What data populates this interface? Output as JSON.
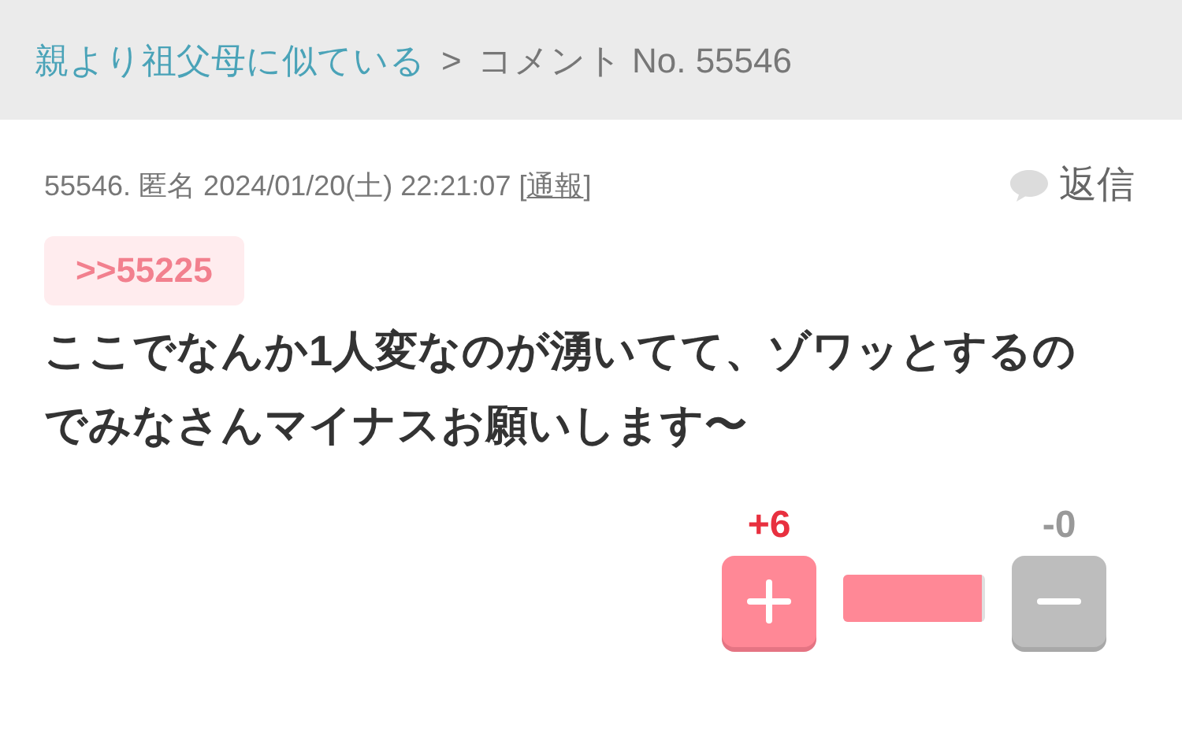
{
  "breadcrumb": {
    "link": "親より祖父母に似ている",
    "separator": ">",
    "current": "コメント No. 55546"
  },
  "comment": {
    "meta": "55546. 匿名 2024/01/20(土) 22:21:07 [",
    "report": "通報",
    "meta_end": "]",
    "reply": "返信",
    "anchor": ">>55225",
    "body": "ここでなんか1人変なのが湧いてて、ゾワッとするのでみなさんマイナスお願いします〜"
  },
  "votes": {
    "plus": "+6",
    "minus": "-0",
    "level": 0.98
  }
}
